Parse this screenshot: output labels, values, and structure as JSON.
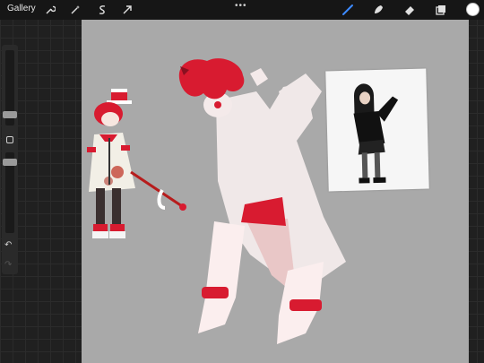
{
  "toolbar": {
    "gallery_label": "Gallery",
    "more_label": "•••",
    "active_color": "#ffffff",
    "icons": [
      "wrench-icon",
      "magic-wand-icon",
      "selection-icon",
      "transform-arrow-icon",
      "brush-icon",
      "smudge-icon",
      "eraser-icon",
      "layers-icon"
    ]
  },
  "sidebar": {
    "undo_label": "↶",
    "redo_label": "↷"
  },
  "canvas": {
    "background": "#a9a9a9"
  }
}
